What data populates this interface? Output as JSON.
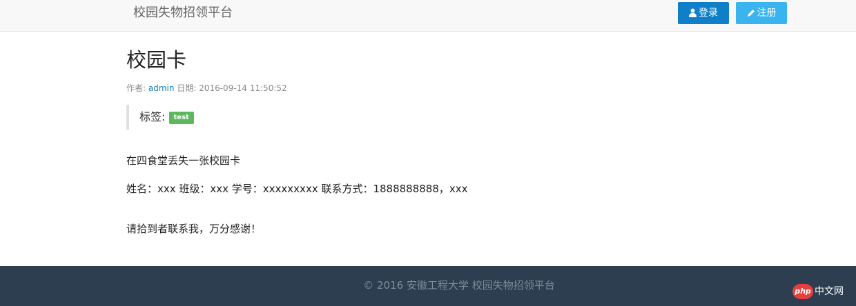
{
  "navbar": {
    "brand": "校园失物招领平台",
    "login_label": "登录",
    "register_label": "注册"
  },
  "post": {
    "title": "校园卡",
    "author_prefix": "作者:",
    "author": "admin",
    "date_prefix": "日期:",
    "date": "2016-09-14 11:50:52",
    "tags_label": "标签:",
    "tag": "test",
    "paragraphs": [
      "在四食堂丢失一张校园卡",
      "姓名：xxx 班级：xxx 学号：xxxxxxxxx 联系方式：1888888888，xxx",
      "请拾到者联系我，万分感谢！"
    ]
  },
  "footer": {
    "text": "© 2016 安徽工程大学 校园失物招领平台"
  },
  "watermark": {
    "logo": "php",
    "site": "中文网"
  },
  "icons": {
    "login": "user-icon",
    "register": "pencil-icon"
  },
  "colors": {
    "login_button": "#0f7fc8",
    "register_button": "#3ab4ee",
    "tag_badge": "#5cb85c",
    "link": "#1a82c5",
    "footer_bg": "#2c3e50"
  }
}
